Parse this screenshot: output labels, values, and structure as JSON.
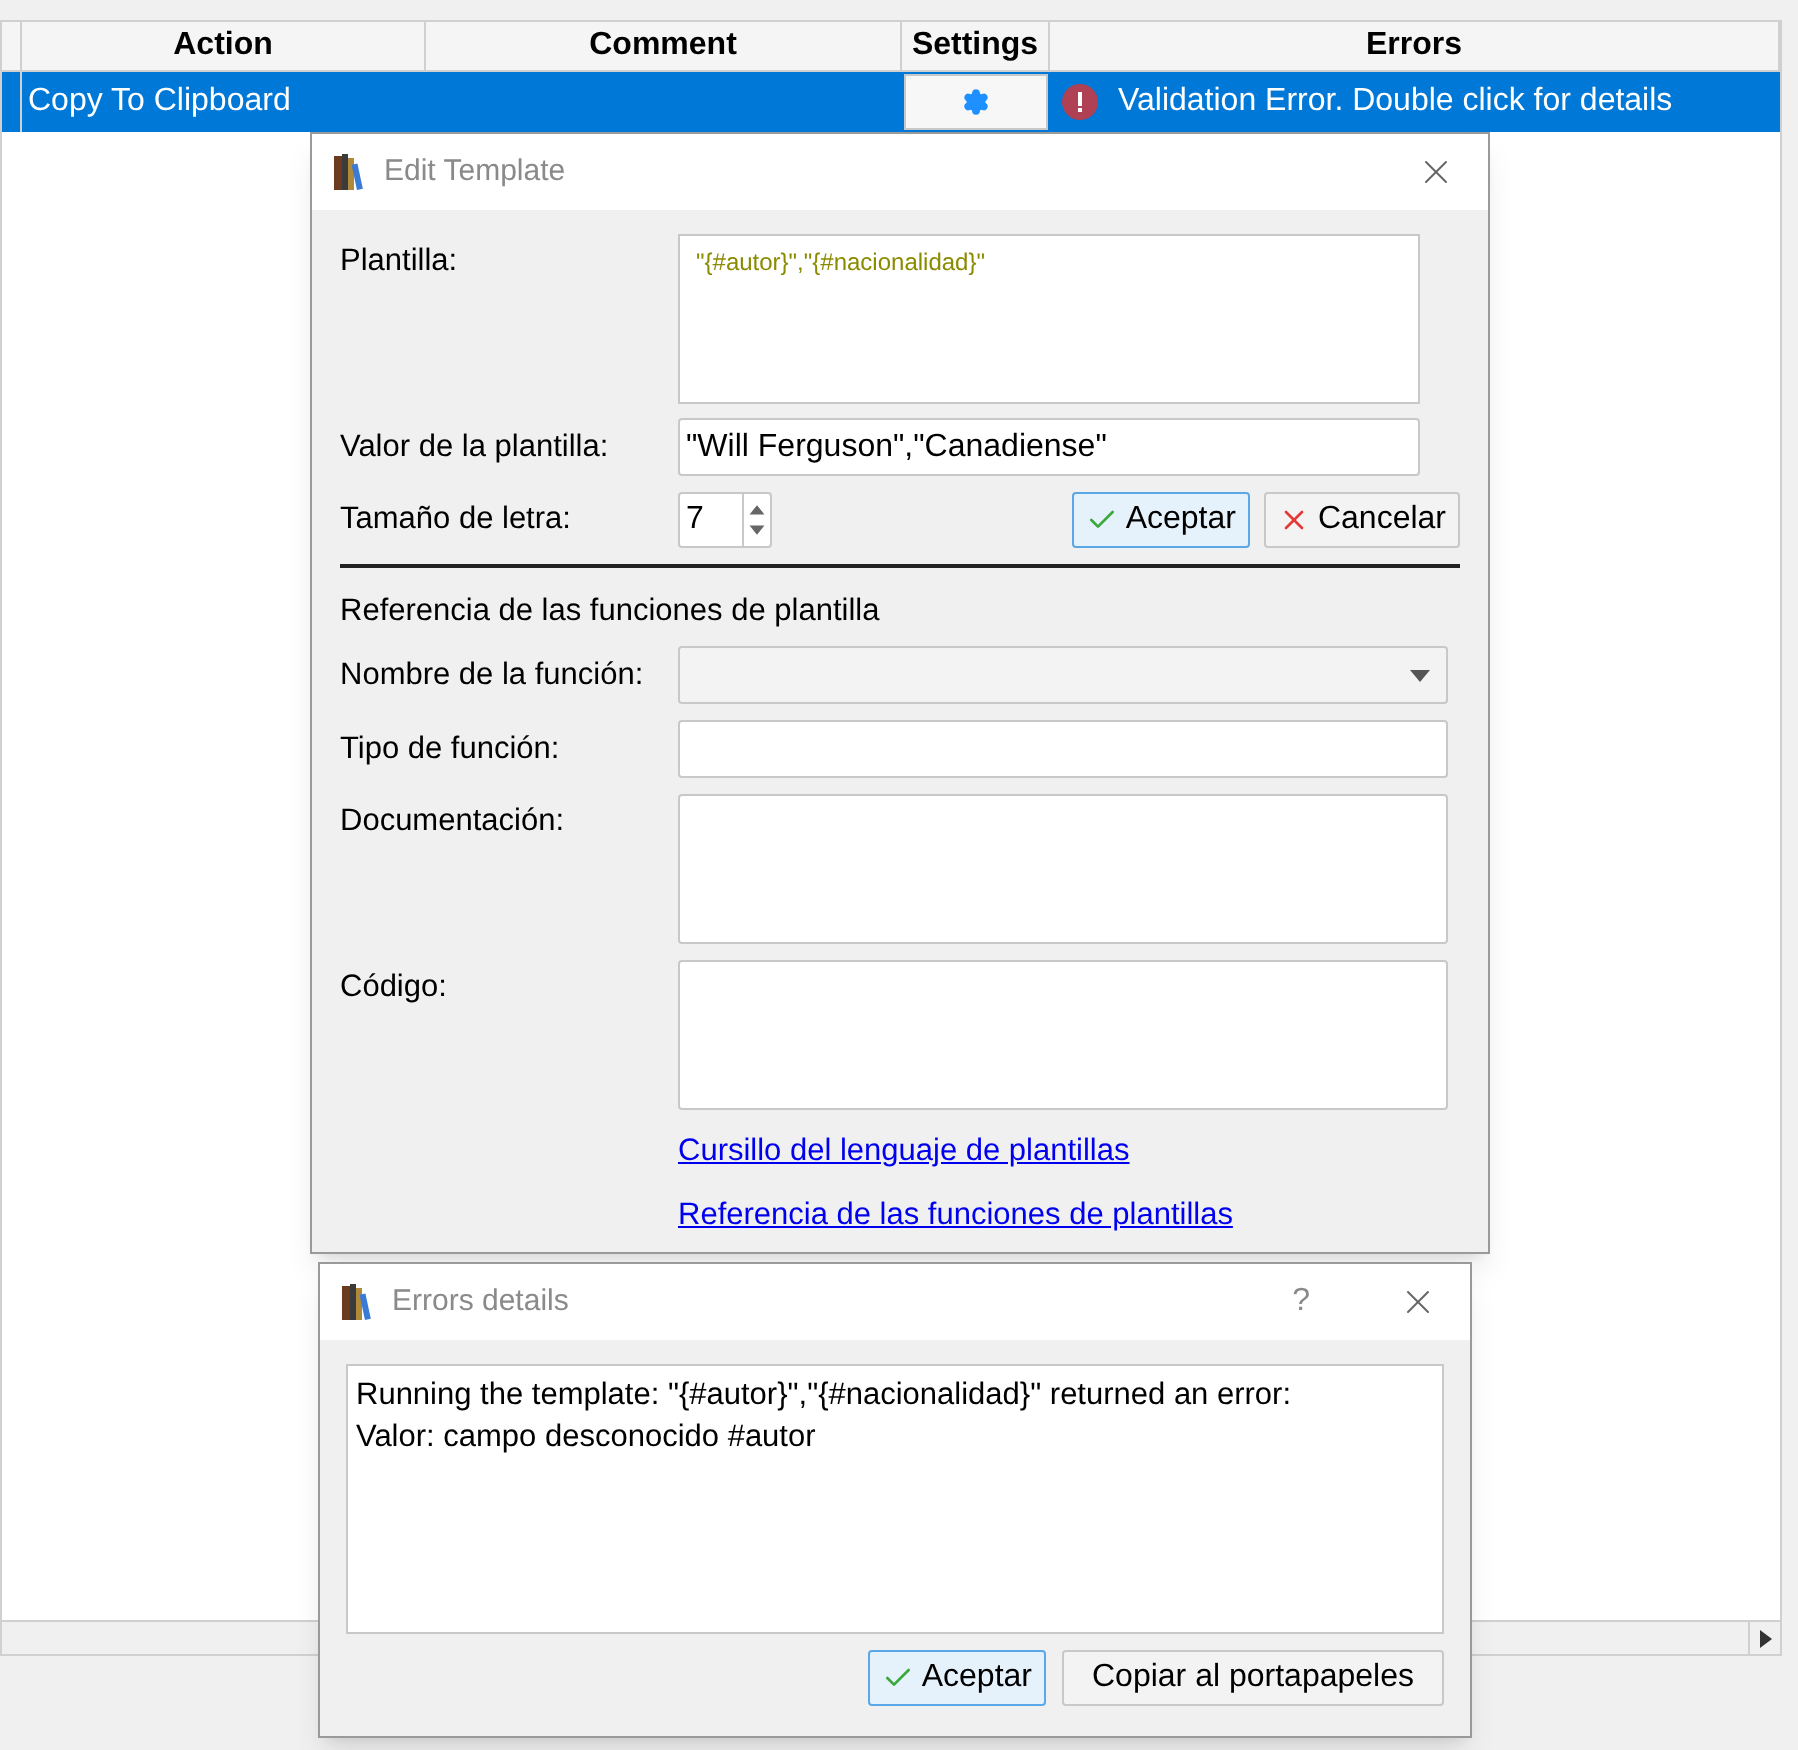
{
  "table": {
    "columns": [
      "Action",
      "Comment",
      "Settings",
      "Errors"
    ],
    "rows": [
      {
        "action": "Copy To Clipboard",
        "selected": true,
        "error": "Validation Error. Double click for details"
      }
    ]
  },
  "edit_template": {
    "title": "Edit Template",
    "template_label": "Plantilla:",
    "template": "\"{#autor}\",\"{#nacionalidad}\"",
    "value_label": "Valor de la plantilla:",
    "value": "\"Will Ferguson\",\"Canadiense\"",
    "font_size_label": "Tamaño de letra:",
    "font_size": "7",
    "accept": "Aceptar",
    "cancel": "Cancelar",
    "reference_heading": "Referencia de las funciones de plantilla",
    "fields": [
      {
        "label": "Nombre de la función:",
        "kind": "dropdown"
      },
      {
        "label": "Tipo de función:",
        "kind": "input"
      },
      {
        "label": "Documentación:",
        "kind": "textarea"
      },
      {
        "label": "Código:",
        "kind": "textarea"
      }
    ],
    "links": [
      "Cursillo del lenguaje de plantillas",
      "Referencia de las funciones de plantillas"
    ]
  },
  "errors_dialog": {
    "title": "Errors details",
    "help": "?",
    "message": [
      "Running the template: \"{#autor}\",\"{#nacionalidad}\" returned an error:",
      "Valor: campo desconocido #autor"
    ],
    "buttons": [
      {
        "label": "Aceptar",
        "kind": "accept"
      },
      {
        "label": "Copiar al portapapeles",
        "kind": "plain"
      }
    ]
  }
}
